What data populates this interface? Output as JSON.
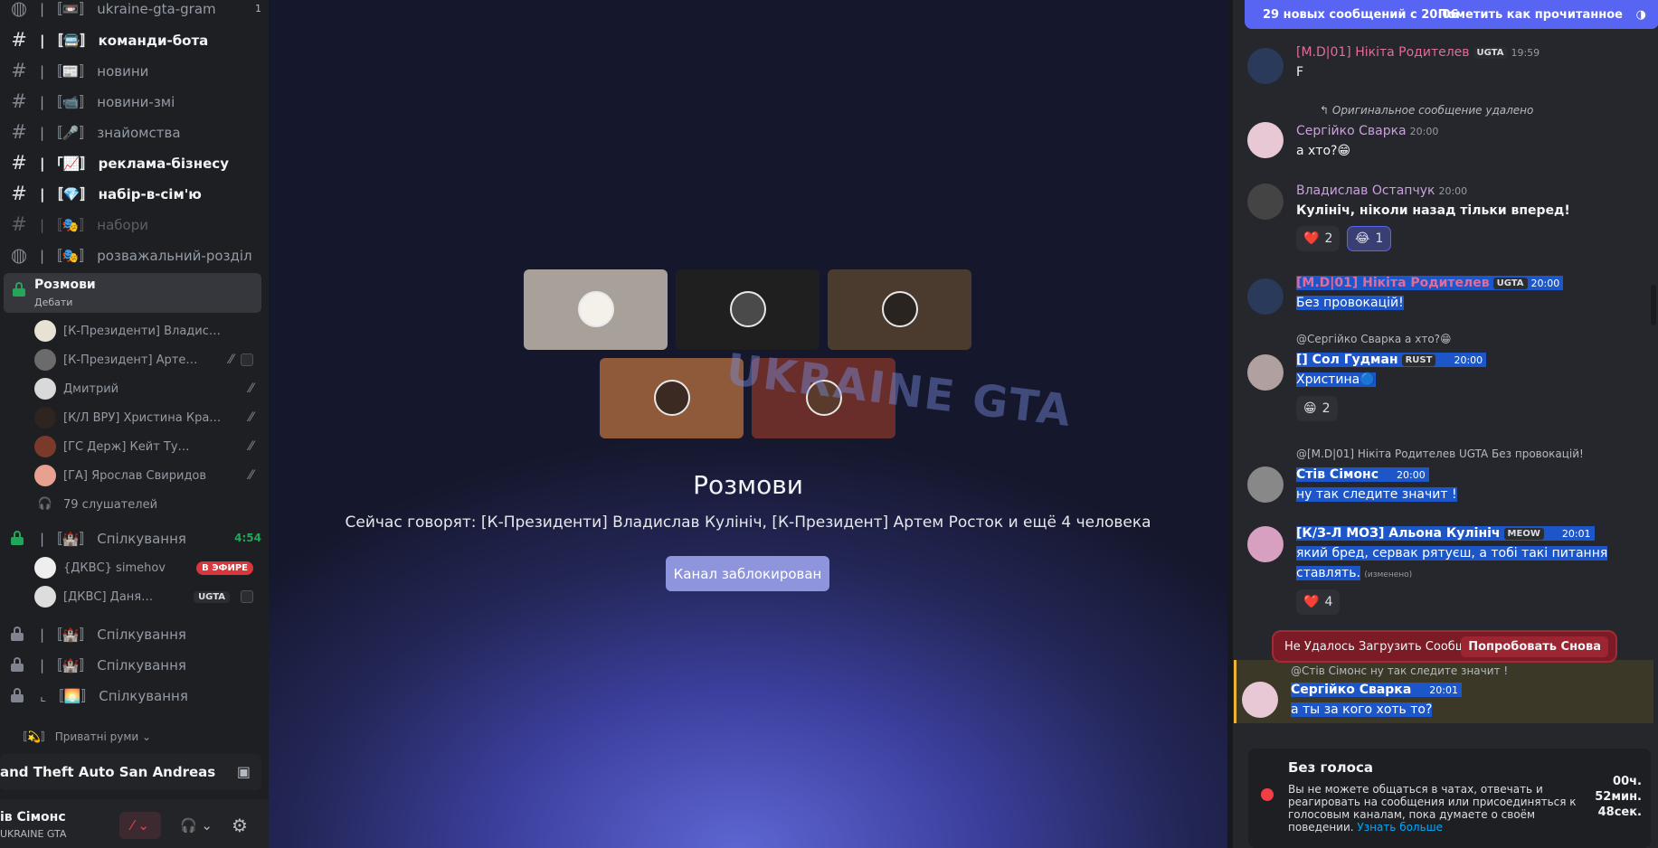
{
  "channels": [
    {
      "prefix": "| 〚📼〛",
      "name": "ukraine-gta-gram",
      "count": "1"
    },
    {
      "prefix": "| 〚🚍〛",
      "name": "команди-бота"
    },
    {
      "prefix": "| 〚📰〛",
      "name": "новини"
    },
    {
      "prefix": "| 〚📹〛",
      "name": "новини-змі"
    },
    {
      "prefix": "| 〚🎤〛",
      "name": "знайомства"
    },
    {
      "prefix": "| 「📈〛",
      "name": "реклама-бізнесу"
    },
    {
      "prefix": "| 〚💎〛",
      "name": "набір-в-сім'ю"
    },
    {
      "prefix": "| 〚🎭〛",
      "name": "набори"
    },
    {
      "prefix": "| 〚🎭〛",
      "name": "розважальний-розділ"
    }
  ],
  "active_voice": {
    "name": "Розмови",
    "topic": "Дебати"
  },
  "voice_users": [
    "[К-Президенти] Владислав Куліч...",
    "[К-Президент] Артем Р...",
    "Дмитрий",
    "[К/Л ВРУ] Христина Кравче...",
    "[ГС Держ] Кейт Туман",
    "[ГА] Ярослав Свиридов"
  ],
  "listeners": "79 слушателей",
  "channel_spilk_1": {
    "name": "| 〚🏰〛 Спілкування",
    "timer": "4:54"
  },
  "voice_users_2": [
    {
      "name": "{ДКВС} simehov",
      "live": "В ЭФИРЕ"
    },
    {
      "name": "[ДКВС] Даня Париж",
      "tag": "UGTA"
    }
  ],
  "locked_channels": [
    "| 〚🏰〛 Спілкування",
    "| 〚🏰〛 Спілкування",
    "⌞ 〚🌅〛 Спілкування"
  ],
  "private_category": "〚💫〛 Приватні руми",
  "activity": "and Theft Auto San Andreas",
  "user": {
    "name": "ів Сімонс",
    "server": "UKRAINE GTA"
  },
  "stage": {
    "title": "Розмови",
    "speakers": "Сейчас говорят: [К-Президенти] Владислав Кулініч, [К-Президент] Артем Росток и ещё 4 человека",
    "locked_button": "Канал заблокирован",
    "watermark": "UKRAINE GTA"
  },
  "chat": {
    "banner_left": "29 новых сообщений с 20:06",
    "banner_right": "Пометить как прочитанное",
    "messages": [
      {
        "author": "[M.D|01] Нікіта Родителев",
        "badge": "UGTA",
        "time": "19:59",
        "text": "F"
      },
      {
        "reply": "↰ Оригинальное сообщение удалено",
        "author": "Сергійко Сварка",
        "time": "20:00",
        "text": "а хто?😁"
      },
      {
        "author": "Владислав Остапчук",
        "time": "20:00",
        "text": "Кулініч, ніколи назад тільки вперед!",
        "reactions": [
          {
            "e": "❤️",
            "n": "2"
          },
          {
            "e": "😂",
            "n": "1"
          }
        ]
      },
      {
        "author": "[M.D|01] Нікіта Родителев",
        "badge": "UGTA",
        "time": "20:00",
        "text": "Без провокацій!"
      },
      {
        "reply": "@Сергійко Сварка а хто?😁",
        "author": "[] Сол Гудман",
        "badge": "RUST",
        "time": "20:00",
        "text": "Христина🔵",
        "reactions": [
          {
            "e": "😁",
            "n": "2"
          }
        ]
      },
      {
        "reply": "@[M.D|01] Нікіта Родителев UGTA Без провокацій!",
        "author": "Стів Сімонс",
        "time": "20:00",
        "text": "ну так следите значит !"
      },
      {
        "author": "[К/З-Л МОЗ] Альона Кулініч",
        "badge": "MEOW",
        "time": "20:01",
        "text": "який бред, сервак рятуєш, а тобі такі питання",
        "text2": "ставлять.",
        "edited": "(изменено)",
        "reactions": [
          {
            "e": "❤️",
            "n": "4"
          }
        ]
      },
      {
        "reply": "@Стів Сімонс ну так следите значит !",
        "author": "Сергійко Сварка",
        "time": "20:01",
        "text": "а ты за кого хоть то?"
      }
    ],
    "error": "Не Удалось Загрузить Сообщения",
    "retry": "Попробовать Снова"
  },
  "timeout": {
    "title": "Без голоса",
    "text": "Вы не можете общаться в чатах, отвечать и реагировать на сообщения или присоединяться к голосовым каналам, пока думаете о своём поведении.",
    "link": "Узнать больше",
    "h": "00ч.",
    "m": "52мин.",
    "s": "48сек."
  },
  "colors": {
    "accent": "#5865f2",
    "selection": "#1c56c9",
    "error": "#7a1b25",
    "online": "#23a55a"
  }
}
